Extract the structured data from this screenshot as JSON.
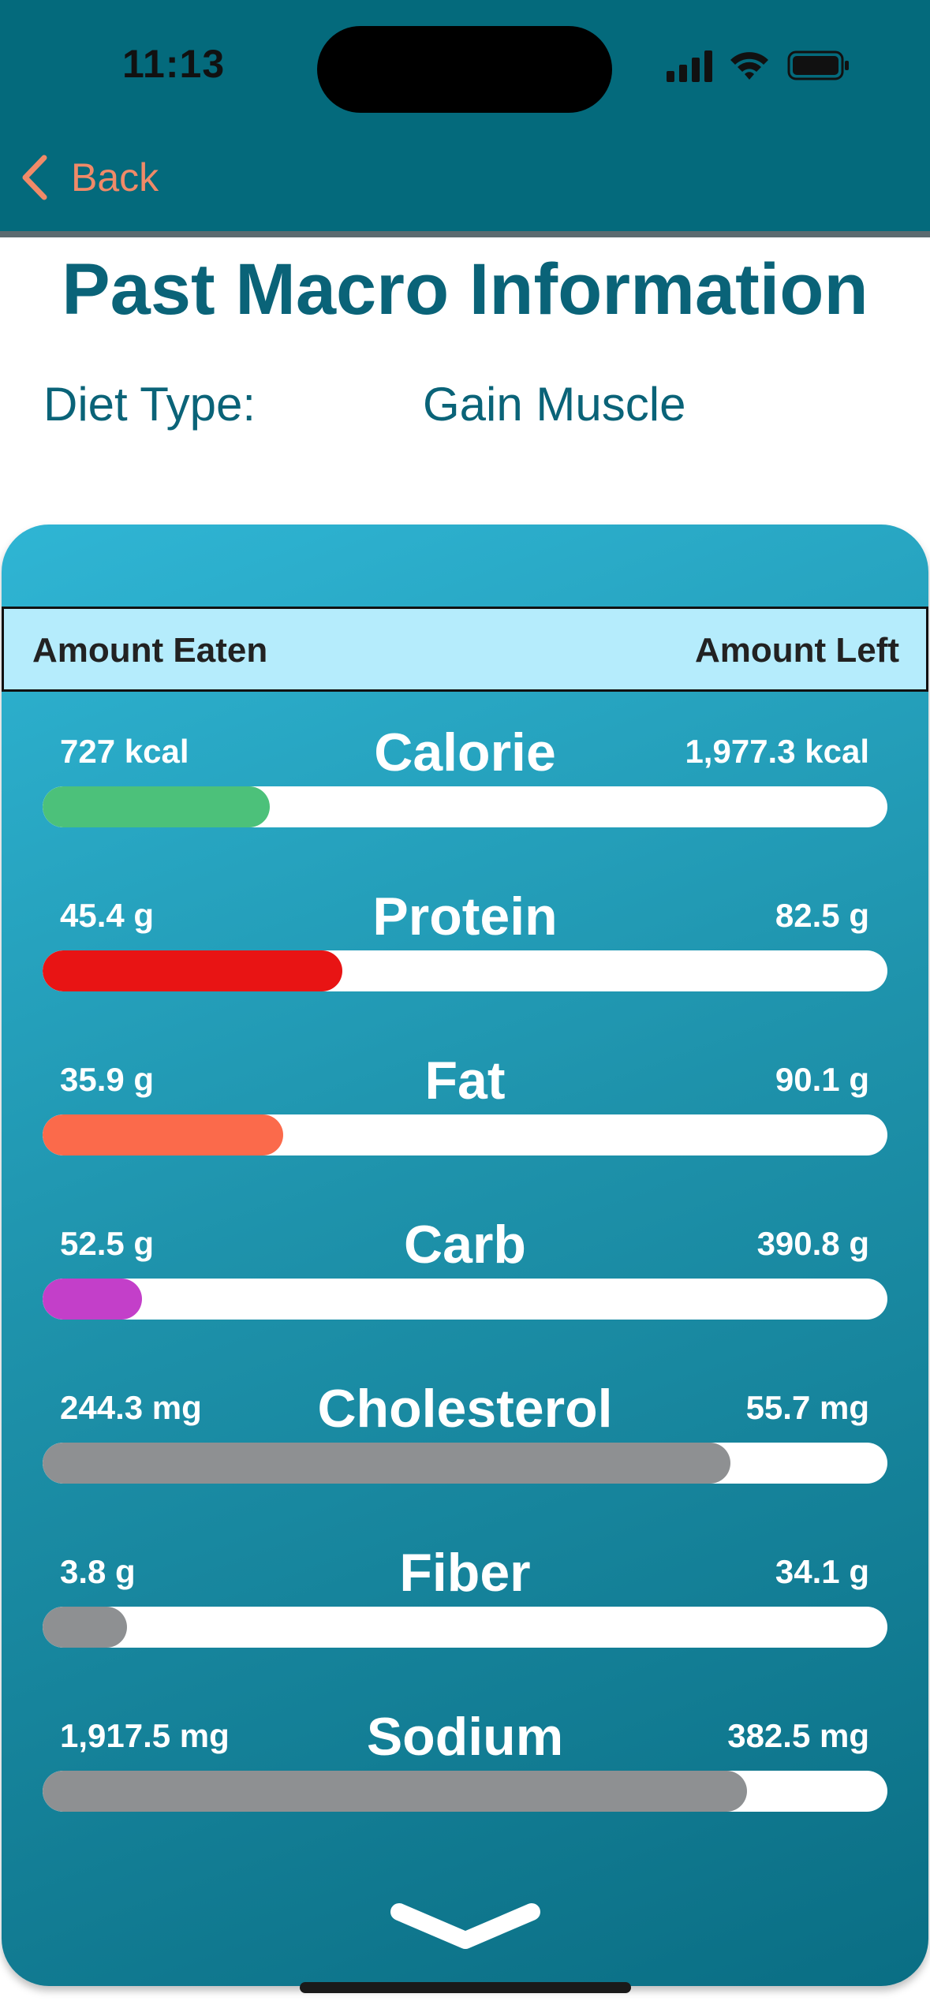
{
  "status_bar": {
    "time": "11:13"
  },
  "nav": {
    "back_label": "Back"
  },
  "page": {
    "title": "Past Macro Information",
    "diet_label": "Diet Type:",
    "diet_value": "Gain Muscle"
  },
  "table": {
    "header_left": "Amount Eaten",
    "header_right": "Amount Left"
  },
  "macros": [
    {
      "name": "Calorie",
      "eaten": "727 kcal",
      "left": "1,977.3 kcal",
      "fraction": 0.269,
      "color": "#4cc17a"
    },
    {
      "name": "Protein",
      "eaten": "45.4 g",
      "left": "82.5 g",
      "fraction": 0.355,
      "color": "#e81414"
    },
    {
      "name": "Fat",
      "eaten": "35.9 g",
      "left": "90.1 g",
      "fraction": 0.285,
      "color": "#fb6a4b"
    },
    {
      "name": "Carb",
      "eaten": "52.5 g",
      "left": "390.8 g",
      "fraction": 0.118,
      "color": "#c33fc9"
    },
    {
      "name": "Cholesterol",
      "eaten": "244.3 mg",
      "left": "55.7 mg",
      "fraction": 0.814,
      "color": "#8e9092"
    },
    {
      "name": "Fiber",
      "eaten": "3.8 g",
      "left": "34.1 g",
      "fraction": 0.1,
      "color": "#8e9092"
    },
    {
      "name": "Sodium",
      "eaten": "1,917.5 mg",
      "left": "382.5 mg",
      "fraction": 0.834,
      "color": "#8e9092"
    }
  ],
  "colors": {
    "header_bg": "#046a7c",
    "accent_text": "#0a6378",
    "back_text": "#f08a68",
    "table_header_bg": "#b5ecfc"
  },
  "icons": {
    "back": "chevron-left-icon",
    "expand": "chevron-down-icon",
    "signal": "cellular-signal-icon",
    "wifi": "wifi-icon",
    "battery": "battery-icon"
  }
}
